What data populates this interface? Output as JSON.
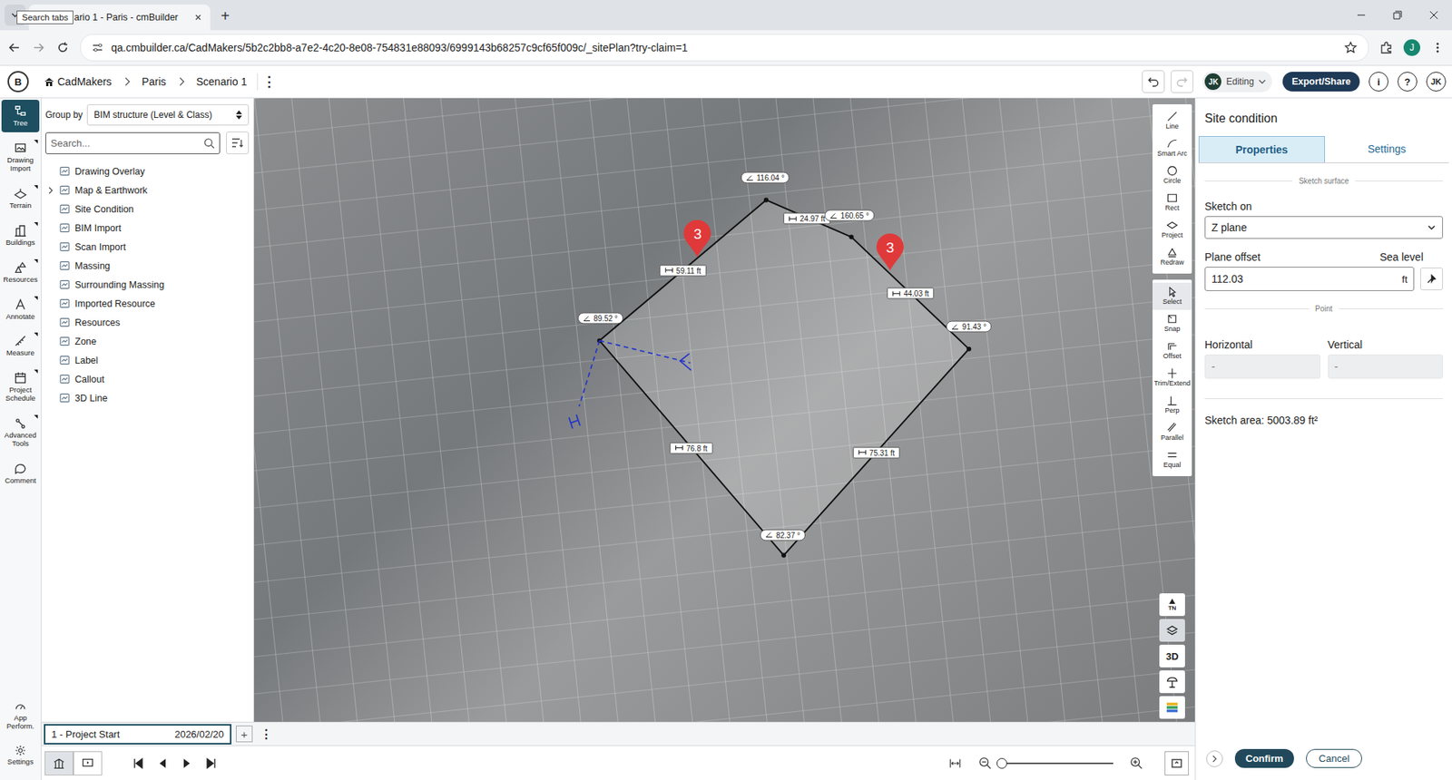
{
  "browser": {
    "tab_tooltip": "Search tabs",
    "tab_title": "ario 1 - Paris - cmBuilder",
    "new_tab": "+",
    "url": "qa.cmbuilder.ca/CadMakers/5b2c2bb8-a7e2-4c20-8e08-754831e88093/6999143b68257c9cf65f009c/_sitePlan?try-claim=1",
    "profile": "J"
  },
  "header": {
    "logo": "B",
    "breadcrumbs": [
      "CadMakers",
      "Paris",
      "Scenario 1"
    ],
    "menu": "⋮",
    "mode_user": "JK",
    "mode": "Editing",
    "export": "Export/Share",
    "info": "i",
    "help": "?",
    "avatar": "JK"
  },
  "rail": {
    "items": [
      {
        "label": "Tree",
        "selected": true,
        "has_menu": false
      },
      {
        "label": "Drawing Import",
        "selected": false,
        "has_menu": true
      },
      {
        "label": "Terrain",
        "selected": false,
        "has_menu": true
      },
      {
        "label": "Buildings",
        "selected": false,
        "has_menu": true
      },
      {
        "label": "Resources",
        "selected": false,
        "has_menu": true
      },
      {
        "label": "Annotate",
        "selected": false,
        "has_menu": true
      },
      {
        "label": "Measure",
        "selected": false,
        "has_menu": true
      },
      {
        "label": "Project Schedule",
        "selected": false,
        "has_menu": true
      },
      {
        "label": "Advanced Tools",
        "selected": false,
        "has_menu": true
      },
      {
        "label": "Comment",
        "selected": false,
        "has_menu": false
      }
    ],
    "bottom": [
      {
        "label": "App Perform."
      },
      {
        "label": "Settings"
      }
    ]
  },
  "tree": {
    "group_by_label": "Group by",
    "group_by_value": "BIM structure (Level & Class)",
    "search_placeholder": "Search...",
    "items": [
      {
        "label": "Drawing Overlay",
        "expandable": false
      },
      {
        "label": "Map & Earthwork",
        "expandable": true
      },
      {
        "label": "Site Condition",
        "expandable": false
      },
      {
        "label": "BIM Import",
        "expandable": false
      },
      {
        "label": "Scan Import",
        "expandable": false
      },
      {
        "label": "Massing",
        "expandable": false
      },
      {
        "label": "Surrounding Massing",
        "expandable": false
      },
      {
        "label": "Imported Resource",
        "expandable": false
      },
      {
        "label": "Resources",
        "expandable": false
      },
      {
        "label": "Zone",
        "expandable": false
      },
      {
        "label": "Label",
        "expandable": false
      },
      {
        "label": "Callout",
        "expandable": false
      },
      {
        "label": "3D Line",
        "expandable": false
      }
    ]
  },
  "map": {
    "labels": [
      {
        "kind": "angle",
        "text": "116.04 °"
      },
      {
        "kind": "length",
        "text": "24.97 ft"
      },
      {
        "kind": "angle",
        "text": "160.65 °"
      },
      {
        "kind": "length",
        "text": "59.11 ft"
      },
      {
        "kind": "length",
        "text": "44.03 ft"
      },
      {
        "kind": "angle",
        "text": "89.52 °"
      },
      {
        "kind": "angle",
        "text": "91.43 °"
      },
      {
        "kind": "length",
        "text": "76.8 ft"
      },
      {
        "kind": "length",
        "text": "75.31 ft"
      },
      {
        "kind": "angle",
        "text": "82.37 °"
      }
    ],
    "markers": [
      {
        "text": "3"
      },
      {
        "text": "3"
      }
    ]
  },
  "tools": {
    "draw": [
      {
        "label": "Line",
        "selected": false
      },
      {
        "label": "Smart Arc",
        "selected": false
      },
      {
        "label": "Circle",
        "selected": false
      },
      {
        "label": "Rect",
        "selected": false
      },
      {
        "label": "Project",
        "selected": false
      },
      {
        "label": "Redraw",
        "selected": false
      }
    ],
    "edit": [
      {
        "label": "Select",
        "selected": true
      },
      {
        "label": "Snap",
        "selected": false
      },
      {
        "label": "Offset",
        "selected": false
      },
      {
        "label": "Trim/Extend",
        "selected": false
      },
      {
        "label": "Perp",
        "selected": false
      },
      {
        "label": "Parallel",
        "selected": false
      },
      {
        "label": "Equal",
        "selected": false
      }
    ]
  },
  "view_buttons": [
    {
      "kind": "north",
      "label": "TN",
      "selected": false
    },
    {
      "kind": "layers",
      "selected": true
    },
    {
      "kind": "text",
      "label": "3D",
      "selected": false
    },
    {
      "kind": "sun",
      "selected": false
    },
    {
      "kind": "legend",
      "selected": false
    }
  ],
  "panel": {
    "title": "Site condition",
    "tabs": [
      {
        "label": "Properties",
        "selected": true
      },
      {
        "label": "Settings",
        "selected": false
      }
    ],
    "surface_section": "Sketch surface",
    "sketch_on_label": "Sketch on",
    "sketch_on_value": "Z plane",
    "offset_label": "Plane offset",
    "sea_level_label": "Sea level",
    "offset_value": "112.03",
    "offset_unit": "ft",
    "point_section": "Point",
    "horizontal_label": "Horizontal",
    "horizontal_value": "-",
    "vertical_label": "Vertical",
    "vertical_value": "-",
    "point_disabled": true,
    "sketch_area": "Sketch area: 5003.89 ft²",
    "confirm": "Confirm",
    "cancel": "Cancel"
  },
  "timeline": {
    "phase": "1 - Project Start",
    "date": "2026/02/20",
    "add": "+",
    "menu": "⋮",
    "selected": true
  },
  "zoom": {
    "level": 0.0
  },
  "view_toggle": [
    {
      "selected": true
    },
    {
      "selected": false
    }
  ]
}
